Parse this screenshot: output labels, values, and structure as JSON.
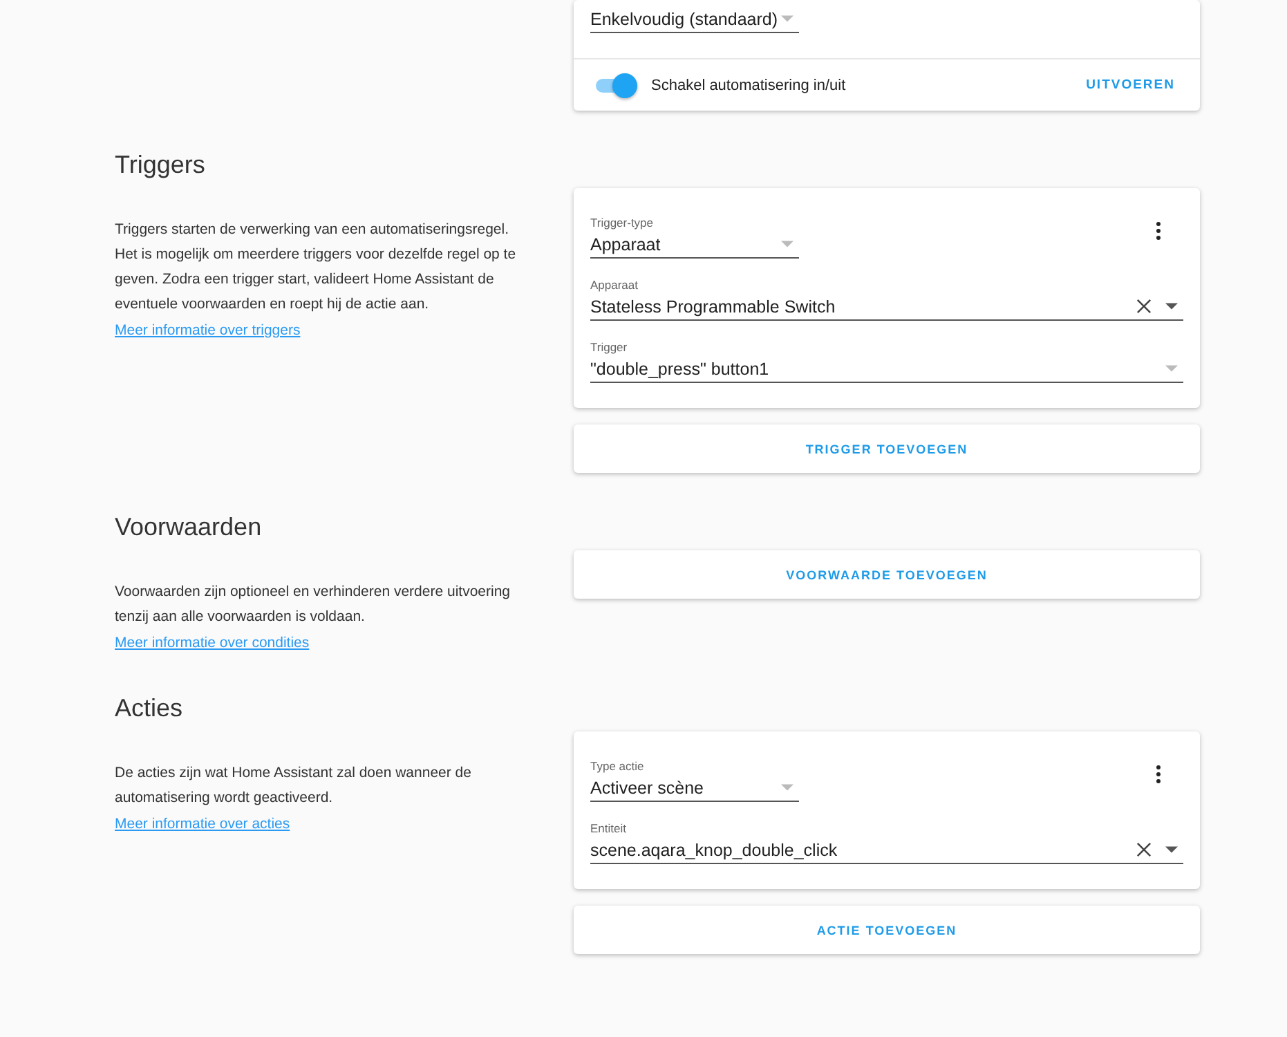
{
  "mode_card": {
    "field": {
      "kind": "short",
      "value": "Enkelvoudig (standaard)"
    },
    "toggle": {
      "on": true,
      "label": "Schakel automatisering in/uit"
    },
    "action": "UITVOEREN"
  },
  "sections": [
    {
      "title": "Triggers",
      "description": "Triggers starten de verwerking van een automatiseringsregel. Het is mogelijk om meerdere triggers voor dezelfde regel op te geven. Zodra een trigger start, valideert Home Assistant de eventuele voorwaarden en roept hij de actie aan.",
      "link": "Meer informatie over triggers",
      "cards": [
        {
          "fields": [
            {
              "kind": "short",
              "label": "Trigger-type",
              "value": "Apparaat",
              "clearable": false
            },
            {
              "kind": "wide",
              "label": "Apparaat",
              "value": "Stateless Programmable Switch",
              "clearable": true
            },
            {
              "kind": "wide",
              "label": "Trigger",
              "value": "\"double_press\" button1",
              "clearable": false
            }
          ]
        }
      ],
      "add_button": "TRIGGER TOEVOEGEN"
    },
    {
      "title": "Voorwaarden",
      "description": "Voorwaarden zijn optioneel en verhinderen verdere uitvoering tenzij aan alle voorwaarden is voldaan.",
      "link": "Meer informatie over condities",
      "add_button": "VOORWAARDE TOEVOEGEN"
    },
    {
      "title": "Acties",
      "description": "De acties zijn wat Home Assistant zal doen wanneer de automatisering wordt geactiveerd.",
      "link": "Meer informatie over acties",
      "cards": [
        {
          "fields": [
            {
              "kind": "short",
              "label": "Type actie",
              "value": "Activeer scène",
              "clearable": false
            },
            {
              "kind": "wide",
              "label": "Entiteit",
              "value": "scene.aqara_knop_double_click",
              "clearable": true
            }
          ]
        }
      ],
      "add_button": "ACTIE TOEVOEGEN"
    }
  ]
}
